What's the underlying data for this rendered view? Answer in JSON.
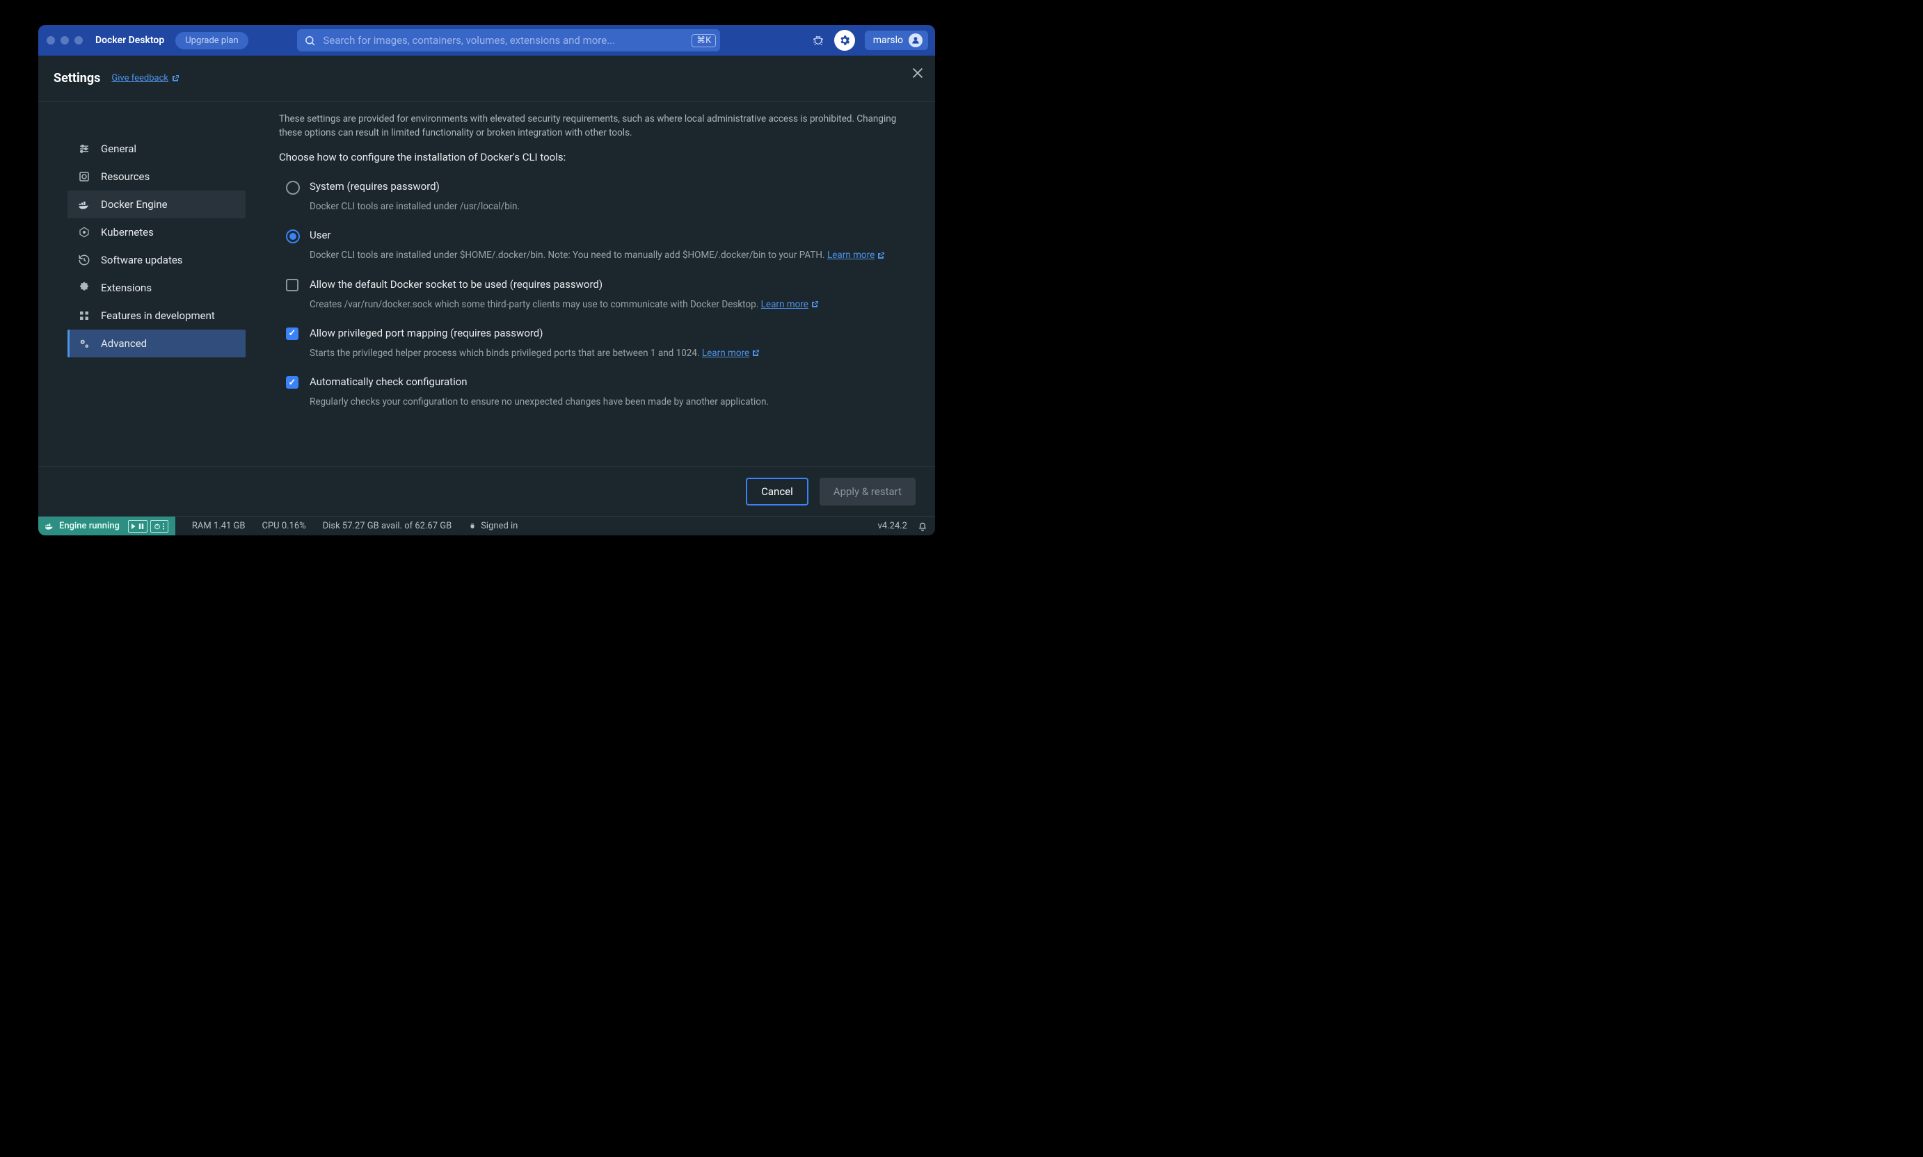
{
  "titlebar": {
    "app": "Docker Desktop",
    "upgrade": "Upgrade plan",
    "search_placeholder": "Search for images, containers, volumes, extensions and more...",
    "shortcut": "⌘K",
    "username": "marslo"
  },
  "header": {
    "title": "Settings",
    "feedback": "Give feedback"
  },
  "sidebar": {
    "general": "General",
    "resources": "Resources",
    "docker_engine": "Docker Engine",
    "kubernetes": "Kubernetes",
    "software_updates": "Software updates",
    "extensions": "Extensions",
    "features": "Features in development",
    "advanced": "Advanced"
  },
  "content": {
    "warning": "These settings are provided for environments with elevated security requirements, such as where local administrative access is prohibited. Changing these options can result in limited functionality or broken integration with other tools.",
    "prompt": "Choose how to configure the installation of Docker's CLI tools:",
    "system": {
      "label": "System (requires password)",
      "desc": "Docker CLI tools are installed under /usr/local/bin."
    },
    "user": {
      "label": "User",
      "desc_pre": "Docker CLI tools are installed under $HOME/.docker/bin. Note: You need to manually add $HOME/.docker/bin to your PATH. ",
      "learn_more": "Learn more"
    },
    "socket": {
      "label": "Allow the default Docker socket to be used (requires password)",
      "desc_pre": "Creates /var/run/docker.sock which some third-party clients may use to communicate with Docker Desktop. ",
      "learn_more": "Learn more"
    },
    "privileged": {
      "label": "Allow privileged port mapping (requires password)",
      "desc_pre": "Starts the privileged helper process which binds privileged ports that are between 1 and 1024. ",
      "learn_more": "Learn more"
    },
    "autocheck": {
      "label": "Automatically check configuration",
      "desc": "Regularly checks your configuration to ensure no unexpected changes have been made by another application."
    }
  },
  "footer": {
    "cancel": "Cancel",
    "apply": "Apply & restart"
  },
  "status": {
    "engine": "Engine running",
    "ram": "RAM 1.41 GB",
    "cpu": "CPU 0.16%",
    "disk": "Disk 57.27 GB avail. of 62.67 GB",
    "signed": "Signed in",
    "version": "v4.24.2"
  }
}
